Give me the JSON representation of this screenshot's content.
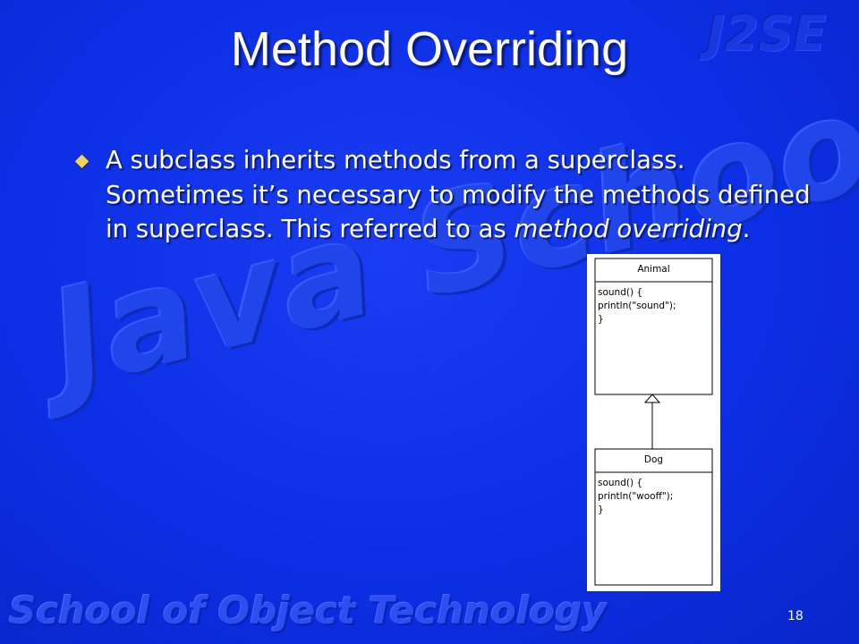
{
  "slide": {
    "title": "Method Overriding",
    "bullet": {
      "text_before": "A subclass inherits methods from a superclass. Sometimes it’s necessary to modify the methods defined in superclass. This referred to as ",
      "text_emphasis": "method overriding",
      "text_after": "."
    },
    "watermarks": {
      "top_right": "J2SE",
      "center": "Java School",
      "bottom": "School of Object Technology"
    },
    "page_number": "18"
  },
  "diagram": {
    "superclass": {
      "name": "Animal",
      "body": "sound() {\nprintln(\"sound\");\n}"
    },
    "subclass": {
      "name": "Dog",
      "body": "sound() {\nprintln(\"wooff\");\n}"
    }
  },
  "colors": {
    "background": "#0c2fe6",
    "title_text": "#fffce8",
    "bullet_icon": "#f4d35a"
  }
}
